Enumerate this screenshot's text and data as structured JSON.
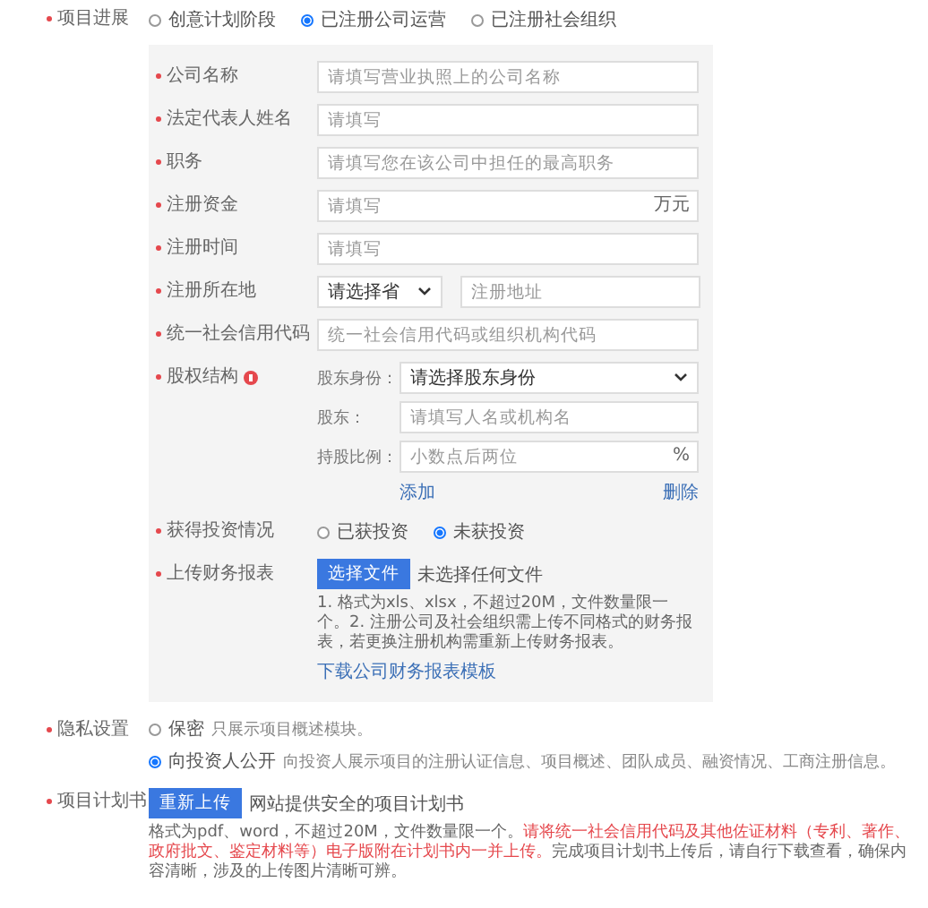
{
  "progress": {
    "label": "项目进展",
    "options": [
      {
        "label": "创意计划阶段",
        "selected": false
      },
      {
        "label": "已注册公司运营",
        "selected": true
      },
      {
        "label": "已注册社会组织",
        "selected": false
      }
    ]
  },
  "company_form": {
    "fields": [
      {
        "kind": "input",
        "label": "公司名称",
        "placeholder": "请填写营业执照上的公司名称"
      },
      {
        "kind": "input",
        "label": "法定代表人姓名",
        "placeholder": "请填写"
      },
      {
        "kind": "input",
        "label": "职务",
        "placeholder": "请填写您在该公司中担任的最高职务"
      },
      {
        "kind": "input",
        "label": "注册资金",
        "placeholder": "请填写",
        "suffix": "万元"
      },
      {
        "kind": "input",
        "label": "注册时间",
        "placeholder": "请填写"
      },
      {
        "kind": "location",
        "label": "注册所在地",
        "select": "请选择省",
        "placeholder": "注册地址"
      },
      {
        "kind": "input",
        "label": "统一社会信用代码",
        "placeholder": "统一社会信用代码或组织机构代码"
      }
    ],
    "equity": {
      "label": "股权结构",
      "rows": [
        {
          "kind": "select",
          "label": "股东身份：",
          "value": "请选择股东身份"
        },
        {
          "kind": "input",
          "label": "股东：",
          "placeholder": "请填写人名或机构名"
        },
        {
          "kind": "input",
          "label": "持股比例：",
          "placeholder": "小数点后两位",
          "suffix": "%"
        }
      ],
      "add_link": "添加",
      "delete_link": "删除"
    },
    "investment": {
      "label": "获得投资情况",
      "options": [
        {
          "label": "已获投资",
          "selected": false
        },
        {
          "label": "未获投资",
          "selected": true
        }
      ]
    },
    "financial_upload": {
      "label": "上传财务报表",
      "button": "选择文件",
      "status": "未选择任何文件",
      "note": "1. 格式为xls、xlsx，不超过20M，文件数量限一个。2. 注册公司及社会组织需上传不同格式的财务报表，若更换注册机构需重新上传财务报表。",
      "link": "下载公司财务报表模板"
    }
  },
  "privacy": {
    "label": "隐私设置",
    "options": [
      {
        "label": "保密",
        "description": "只展示项目概述模块。",
        "selected": false
      },
      {
        "label": "向投资人公开",
        "description": "向投资人展示项目的注册认证信息、项目概述、团队成员、融资情况、工商注册信息。",
        "selected": true
      }
    ]
  },
  "business_plan": {
    "label": "项目计划书",
    "button": "重新上传",
    "status": "网站提供安全的项目计划书",
    "note": [
      {
        "text": "格式为pdf、word，不超过20M，文件数量限一个。",
        "emphasis": false
      },
      {
        "text": "请将统一社会信用代码及其他佐证材料（专利、著作、政府批文、鉴定材料等）电子版附在计划书内一并上传。",
        "emphasis": true
      },
      {
        "text": "完成项目计划书上传后，请自行下载查看，确保内容清晰，涉及的上传图片清晰可辨。",
        "emphasis": false
      }
    ]
  }
}
